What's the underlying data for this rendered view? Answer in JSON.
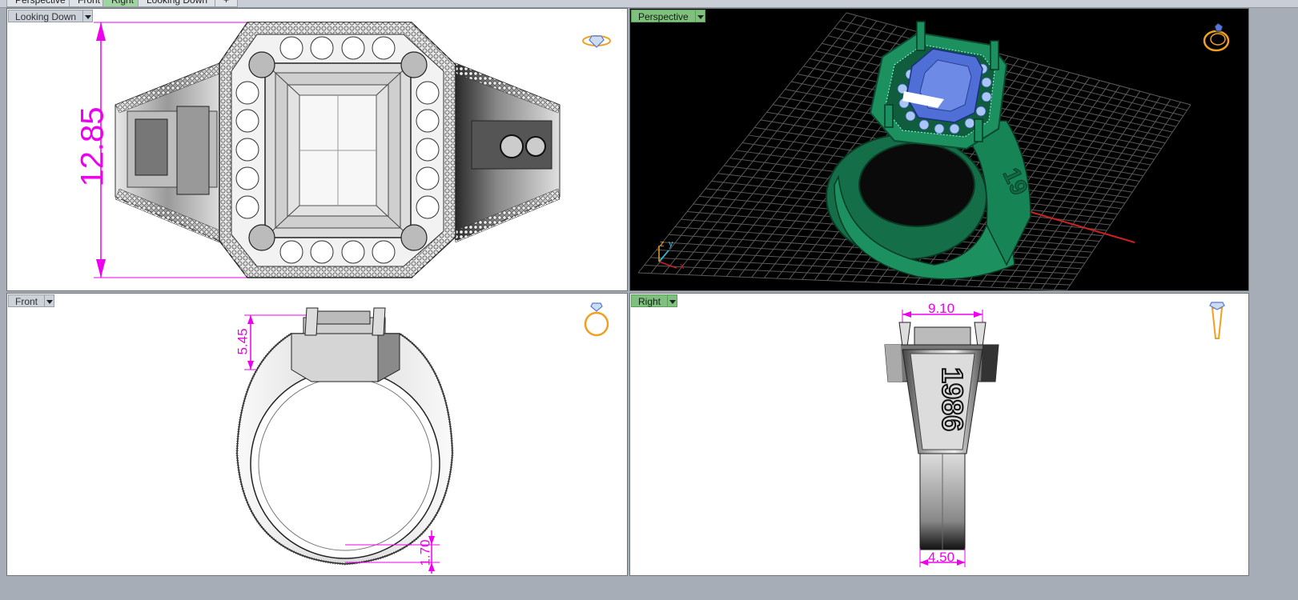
{
  "tabs": [
    {
      "label": "Perspective",
      "active": false
    },
    {
      "label": "Front",
      "active": false
    },
    {
      "label": "Right",
      "active": true
    },
    {
      "label": "Looking Down",
      "active": false
    },
    {
      "label": "+",
      "active": false
    }
  ],
  "viewports": {
    "top_left": {
      "label": "Looking Down",
      "dimension": "12.85",
      "icon": "ring-top-view-icon"
    },
    "top_right": {
      "label": "Perspective",
      "icon": "ring-perspective-icon",
      "axes": {
        "x": "x",
        "y": "y",
        "z": "z"
      }
    },
    "bottom_left": {
      "label": "Front",
      "dimensions": [
        "5.45",
        "1.70"
      ],
      "icon": "ring-front-view-icon"
    },
    "bottom_right": {
      "label": "Right",
      "dimensions": [
        "9.10",
        "4.50"
      ],
      "engraving": "1986",
      "icon": "ring-side-view-icon"
    }
  },
  "colors": {
    "active_label": "#7fc07f",
    "dimension": "#ee00ee",
    "gem": "#5577dd",
    "metal_render": "#1a8a5a",
    "nav_icon": "#f0a020"
  }
}
